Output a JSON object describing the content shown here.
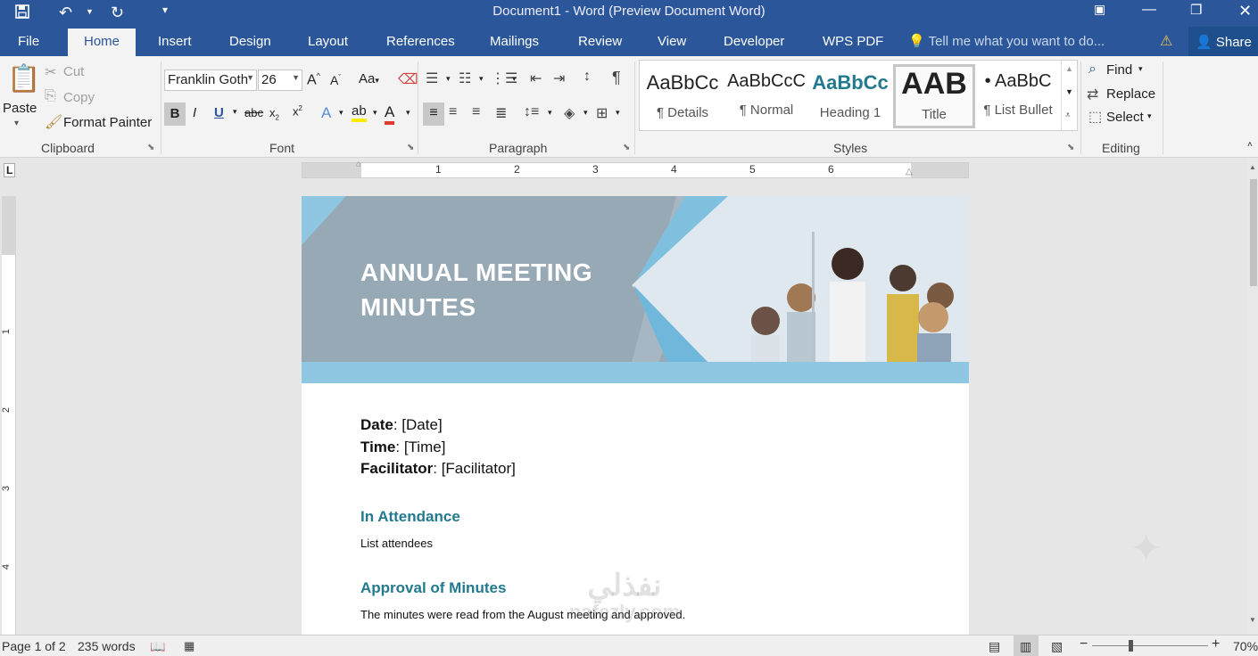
{
  "titlebar": {
    "title": "Document1 - Word (Preview Document Word)",
    "icons": [
      "save-icon",
      "undo-icon",
      "undo-dropdown-icon",
      "redo-icon",
      "customize-icon",
      "ribbon-display-icon",
      "minimize-icon",
      "restore-icon",
      "close-icon"
    ]
  },
  "tabs": [
    "File",
    "Home",
    "Insert",
    "Design",
    "Layout",
    "References",
    "Mailings",
    "Review",
    "View",
    "Developer",
    "WPS PDF"
  ],
  "active_tab": "Home",
  "tell_me": "Tell me what you want to do...",
  "share": "Share",
  "clipboard": {
    "paste": "Paste",
    "cut": "Cut",
    "copy": "Copy",
    "format_painter": "Format Painter",
    "label": "Clipboard"
  },
  "font": {
    "family": "Franklin Goth",
    "size": "26",
    "change_case": "Aa",
    "label": "Font"
  },
  "paragraph": {
    "label": "Paragraph"
  },
  "styles": {
    "label": "Styles",
    "items": [
      {
        "preview": "AaBbCc",
        "name": "¶ Details"
      },
      {
        "preview": "AaBbCcC",
        "name": "¶ Normal"
      },
      {
        "preview": "AaBbCc",
        "name": "Heading 1"
      },
      {
        "preview": "AAB",
        "name": "Title"
      },
      {
        "preview": "• AaBbC",
        "name": "¶ List Bullet"
      }
    ],
    "selected": "Title"
  },
  "editing": {
    "find": "Find",
    "replace": "Replace",
    "select": "Select",
    "label": "Editing"
  },
  "ruler": {
    "numbers": [
      "1",
      "2",
      "3",
      "4",
      "5",
      "6"
    ],
    "vertical": [
      "1",
      "2",
      "3",
      "4"
    ]
  },
  "document": {
    "title_line1": "ANNUAL MEETING",
    "title_line2": "MINUTES",
    "date_label": "Date",
    "date_value": ": [Date]",
    "time_label": "Time",
    "time_value": ": [Time]",
    "facilitator_label": "Facilitator",
    "facilitator_value": ": [Facilitator]",
    "attendance_heading": "In Attendance",
    "attendance_text": "List attendees",
    "approval_heading": "Approval of Minutes",
    "approval_text": "The minutes were read from the August meeting and approved."
  },
  "status": {
    "page": "Page 1 of 2",
    "words": "235 words",
    "zoom": "70%"
  },
  "watermark": {
    "line1": "نفذلي",
    "line2": "nafezly.com"
  },
  "colors": {
    "brand": "#2b579a",
    "heading": "#237a8f",
    "banner": "#98a9b6",
    "banner_stripe": "#8fc7e2"
  }
}
